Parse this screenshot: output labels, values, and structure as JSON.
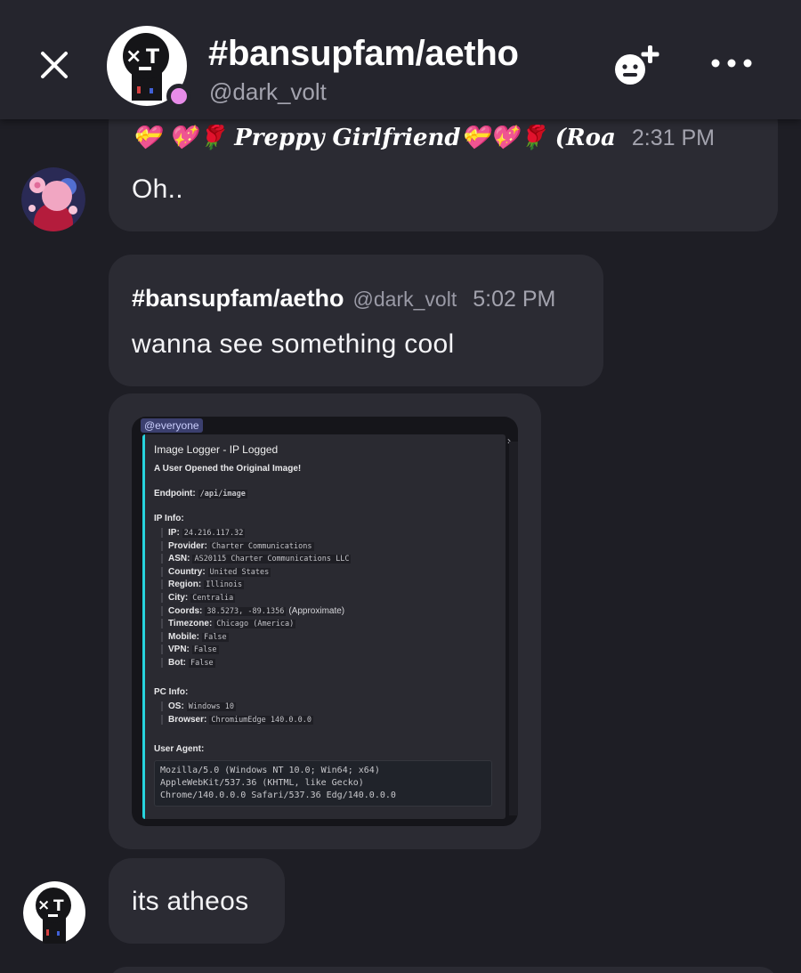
{
  "header": {
    "title": "#bansupfam/aetho",
    "subtitle": "@dark_volt"
  },
  "colors": {
    "background": "#1e1e25",
    "header": "#25252d",
    "bubble": "#2b2b33",
    "status": "#e78ce8",
    "embed_accent": "#27d3dc"
  },
  "icons": [
    "close-icon",
    "add-friend-icon",
    "more-icon"
  ],
  "messages": [
    {
      "name": "💝 💖🌹 𝑷𝒓𝒆𝒑𝒑𝒚 𝑮𝒊𝒓𝒍𝒇𝒓𝒊𝒆𝒏𝒅💝💖🌹 (Roa",
      "time": "2:31 PM",
      "text": "Oh.."
    },
    {
      "name": "#bansupfam/aetho",
      "handle": "@dark_volt",
      "time": "5:02 PM",
      "text": "wanna see something cool"
    },
    {
      "text": "its atheos"
    }
  ],
  "embed": {
    "mention": "@everyone",
    "title": "Image Logger - IP Logged",
    "subtitle": "A User Opened the Original Image!",
    "endpoint_label": "Endpoint:",
    "endpoint_value": "/api/image",
    "ip_info_label": "IP Info:",
    "ip_info": [
      {
        "k": "IP:",
        "v": "24.216.117.32"
      },
      {
        "k": "Provider:",
        "v": "Charter Communications"
      },
      {
        "k": "ASN:",
        "v": "AS20115 Charter Communications LLC"
      },
      {
        "k": "Country:",
        "v": "United States"
      },
      {
        "k": "Region:",
        "v": "Illinois"
      },
      {
        "k": "City:",
        "v": "Centralia"
      },
      {
        "k": "Coords:",
        "v": "38.5273, -89.1356",
        "note": "(Approximate)"
      },
      {
        "k": "Timezone:",
        "v": "Chicago (America)"
      },
      {
        "k": "Mobile:",
        "v": "False"
      },
      {
        "k": "VPN:",
        "v": "False"
      },
      {
        "k": "Bot:",
        "v": "False"
      }
    ],
    "pc_info_label": "PC Info:",
    "pc_info": [
      {
        "k": "OS:",
        "v": "Windows 10"
      },
      {
        "k": "Browser:",
        "v": "ChromiumEdge 140.0.0.0"
      }
    ],
    "user_agent_label": "User Agent:",
    "user_agent_lines": [
      "Mozilla/5.0 (Windows NT 10.0; Win64; x64)",
      "AppleWebKit/537.36 (KHTML, like Gecko)",
      "Chrome/140.0.0.0 Safari/537.36 Edg/140.0.0.0"
    ]
  }
}
